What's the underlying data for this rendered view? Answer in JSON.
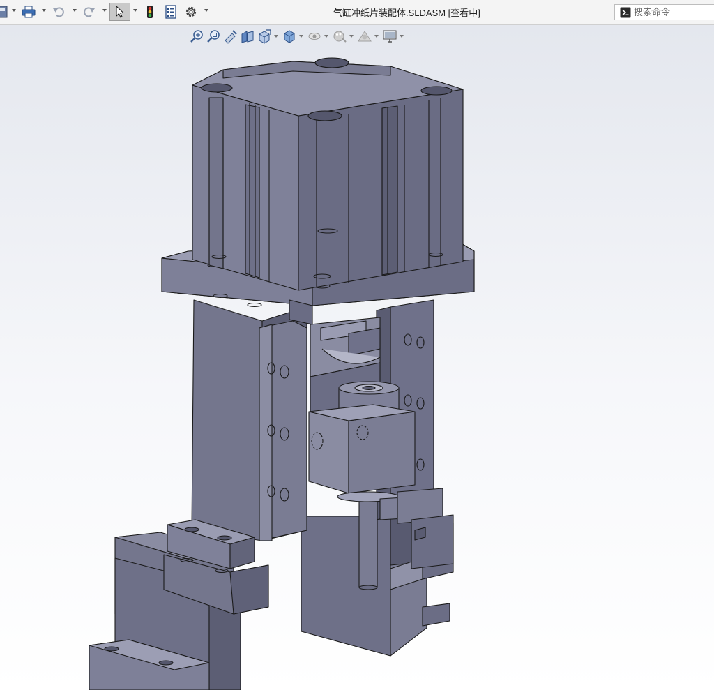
{
  "window": {
    "title": "气缸冲纸片装配体.SLDASM [查看中]"
  },
  "toolbar": {
    "buttons": [
      {
        "name": "save-icon"
      },
      {
        "name": "print-icon"
      },
      {
        "name": "undo-icon"
      },
      {
        "name": "redo-icon"
      },
      {
        "name": "select-cursor-icon",
        "active": true
      },
      {
        "name": "traffic-light-icon"
      },
      {
        "name": "file-properties-icon"
      },
      {
        "name": "options-gear-icon"
      }
    ]
  },
  "search": {
    "placeholder": "搜索命令",
    "value": ""
  },
  "heads_up_toolbar": {
    "items": [
      "zoom-to-fit-icon",
      "zoom-to-area-icon",
      "previous-view-icon",
      "section-view-icon",
      "view-orientation-icon",
      "display-style-icon",
      "hide-show-items-icon",
      "edit-appearance-icon",
      "apply-scene-icon",
      "view-settings-icon"
    ]
  },
  "colors": {
    "part_face_light": "#8e90a6",
    "part_face_mid": "#74768d",
    "part_face_dark": "#5a5c72",
    "edge": "#1a1a1a",
    "viewport_top": "#e4e7ee",
    "viewport_bottom": "#ffffff"
  }
}
